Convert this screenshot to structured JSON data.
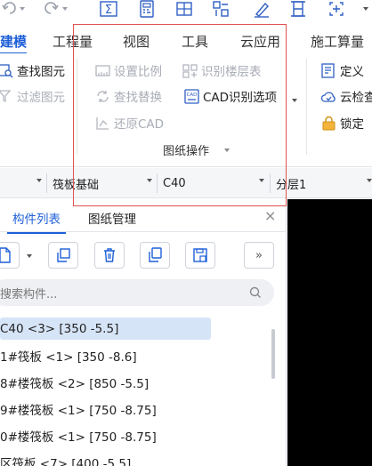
{
  "quick_access": {
    "sum_icon": "Σ"
  },
  "tabs": [
    {
      "label": "建模",
      "active": true
    },
    {
      "label": "工程量",
      "active": false
    },
    {
      "label": "视图",
      "active": false
    },
    {
      "label": "工具",
      "active": false
    },
    {
      "label": "云应用",
      "active": false
    },
    {
      "label": "施工算量",
      "active": false
    }
  ],
  "ribbon": {
    "left_group": {
      "find_element": "查找图元",
      "filter_element": "过滤图元"
    },
    "drawing_group": {
      "set_scale": "设置比例",
      "identify_floor_table": "识别楼层表",
      "find_replace": "查找替换",
      "cad_options": "CAD识别选项",
      "restore_cad": "还原CAD",
      "group_label": "图纸操作"
    },
    "right_group": {
      "define": "定义",
      "cloud_check": "云检查",
      "lock": "锁定"
    }
  },
  "selectors": {
    "component_type": "筏板基础",
    "concrete_grade": "C40",
    "layer": "分层1"
  },
  "panel": {
    "tabs": [
      {
        "label": "构件列表",
        "active": true
      },
      {
        "label": "图纸管理",
        "active": false
      }
    ],
    "close_symbol": "×",
    "more_symbol": "»",
    "search_placeholder": "搜索构件...",
    "items": [
      {
        "label": "C40 <3> [350 -5.5]",
        "selected": true
      },
      {
        "label": "1#筏板 <1> [350 -8.6]",
        "selected": false
      },
      {
        "label": "8#楼筏板 <2> [850 -5.5]",
        "selected": false
      },
      {
        "label": "9#楼筏板 <1> [750 -8.75]",
        "selected": false
      },
      {
        "label": "0#楼筏板 <1> [750 -8.75]",
        "selected": false
      },
      {
        "label": "区筏板 <7> [400 -5.5]",
        "selected": false
      }
    ]
  },
  "colors": {
    "accent": "#1e5fd8",
    "highlight_box": "#e05252",
    "selected_row": "#d6e4f7",
    "disabled_text": "#a9adb6"
  }
}
